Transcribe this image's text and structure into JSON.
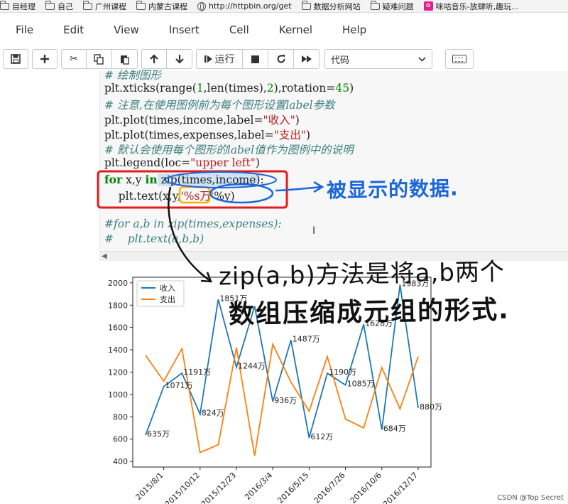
{
  "bookmarks": [
    {
      "icon": "folder-icon",
      "label": "目经理"
    },
    {
      "icon": "folder-icon",
      "label": "自己"
    },
    {
      "icon": "folder-icon",
      "label": "广州课程"
    },
    {
      "icon": "folder-icon",
      "label": "内蒙古课程"
    },
    {
      "icon": "globe-icon",
      "label": "http://httpbin.org/get"
    },
    {
      "icon": "folder-icon",
      "label": "数据分析网站"
    },
    {
      "icon": "folder-icon",
      "label": "疑难问题"
    },
    {
      "icon": "music-icon",
      "label": "咪咕音乐-放肆听,趣玩..."
    }
  ],
  "music_badge": "O",
  "menu": [
    "File",
    "Edit",
    "View",
    "Insert",
    "Cell",
    "Kernel",
    "Help"
  ],
  "toolbar": {
    "run_label": "运行",
    "cell_type": "代码"
  },
  "code": {
    "l0": "# 绘制图形",
    "l1_a": "plt.xticks(range(",
    "l1_b": "1",
    "l1_c": ",len(times),",
    "l1_d": "2",
    "l1_e": "),rotation=",
    "l1_f": "45",
    "l1_g": ")",
    "l2": "# 注意,在使用图例前为每个图形设置label参数",
    "l3_a": "plt.plot(times,income,label=",
    "l3_b": "\"收入\"",
    "l3_c": ")",
    "l4_a": "plt.plot(times,expenses,label=",
    "l4_b": "\"支出\"",
    "l4_c": ")",
    "l5": "# 默认会使用每个图形的label值作为图例中的说明",
    "l6_a": "plt.legend(loc=",
    "l6_b": "\"upper left\"",
    "l6_c": ")",
    "l7_for": "for",
    "l7_mid": " x,y ",
    "l7_in": "in",
    "l7_zip": " zip(times,income)",
    "l7_end": ":",
    "l8_a": "    plt.text(x,y,",
    "l8_b": "'%s万'",
    "l8_c": "%y)",
    "l9": "#for a,b in zip(times,expenses):",
    "l10": "#    plt.text(a,b,b)"
  },
  "annotations": {
    "blue_note": "被显示的数据.",
    "black_note_1": "zip(a,b)方法是将a,b两个",
    "black_note_2": "数组压缩成元组的形式."
  },
  "watermark": "CSDN @Top Secret",
  "chart_data": {
    "type": "line",
    "title": "",
    "xlabel": "",
    "ylabel": "",
    "ylim": [
      350,
      2050
    ],
    "yticks": [
      400,
      600,
      800,
      1000,
      1200,
      1400,
      1600,
      1800,
      2000
    ],
    "xtick_labels": [
      "2015/8/1",
      "2015/10/12",
      "2015/12/23",
      "2016/3/4",
      "2016/5/15",
      "2016/7/26",
      "2016/10/6",
      "2016/12/17"
    ],
    "series": [
      {
        "name": "收入",
        "color": "#1f77b4",
        "values": [
          635,
          1071,
          1191,
          824,
          1851,
          1244,
          1791,
          936,
          1487,
          612,
          1190,
          1085,
          1628,
          684,
          1983,
          880
        ]
      },
      {
        "name": "支出",
        "color": "#ff7f0e",
        "values": [
          1350,
          1120,
          1410,
          480,
          550,
          1420,
          450,
          1450,
          1110,
          850,
          1340,
          780,
          700,
          1240,
          870,
          1340
        ]
      }
    ],
    "data_labels": [
      "635万",
      "1071万",
      "1191万",
      "824万",
      "1851万",
      "1244万",
      "",
      "936万",
      "1487万",
      "612万",
      "1190万",
      "1085万",
      "1628万",
      "684万",
      "1983万",
      "880万"
    ],
    "legend_position": "upper left",
    "grid": false
  }
}
